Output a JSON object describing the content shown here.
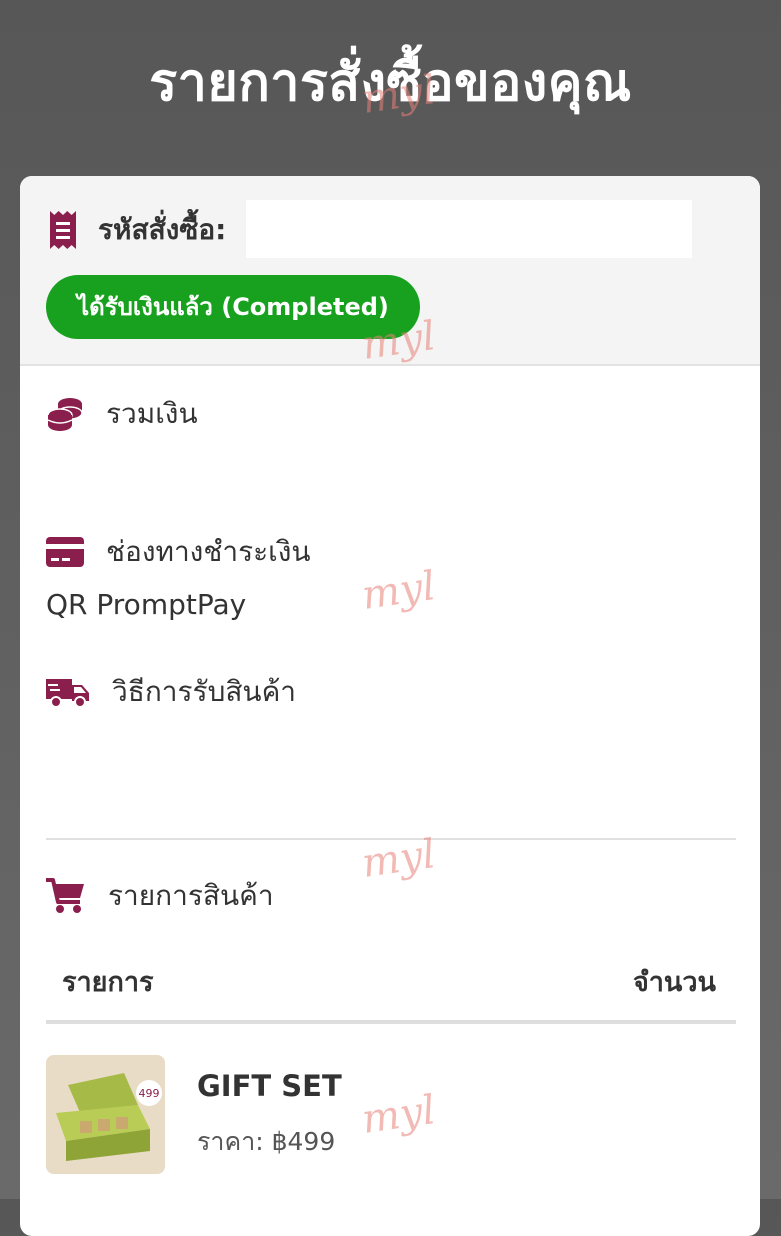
{
  "page": {
    "title": "รายการสั่งซื้อของคุณ"
  },
  "order": {
    "id_label": "รหัสสั่งซื้อ:",
    "id_value": "",
    "status": "ได้รับเงินแล้ว (Completed)"
  },
  "total": {
    "label": "รวมเงิน",
    "value": ""
  },
  "payment": {
    "label": "ช่องทางชำระเงิน",
    "value": "QR PromptPay"
  },
  "delivery": {
    "label": "วิธีการรับสินค้า",
    "value": ""
  },
  "products": {
    "section_label": "รายการสินค้า",
    "col_item": "รายการ",
    "col_qty": "จำนวน",
    "items": [
      {
        "name": "GIFT SET",
        "price": "ราคา: ฿499",
        "thumb_badge": "499"
      }
    ]
  },
  "watermark": "myl",
  "colors": {
    "accent": "#8a1f4e",
    "status_green": "#17a11f",
    "background": "#5a5a5a"
  },
  "icons": {
    "order": "receipt-icon",
    "total": "coins-icon",
    "payment": "credit-card-icon",
    "delivery": "truck-icon",
    "products": "cart-icon"
  }
}
